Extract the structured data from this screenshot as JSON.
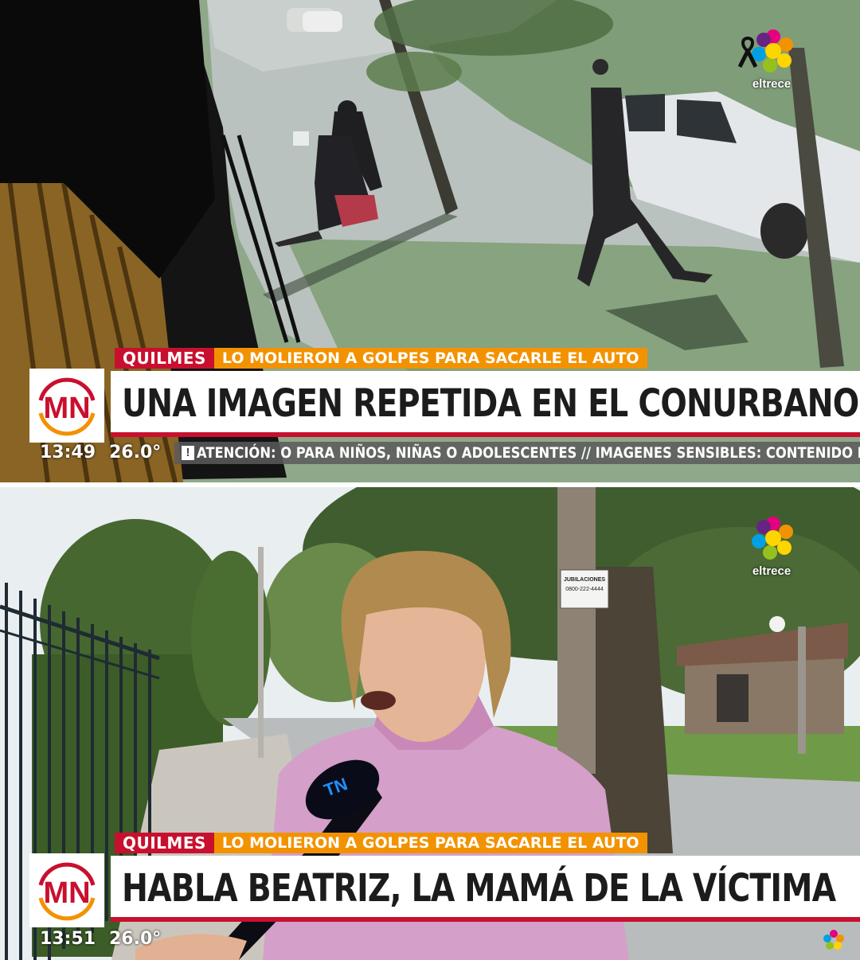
{
  "channel": {
    "name": "eltrece"
  },
  "segments": [
    {
      "kicker_place": "QUILMES",
      "kicker_topic": "LO MOLIERON A GOLPES PARA SACARLE EL AUTO",
      "headline": "UNA IMAGEN REPETIDA EN EL CONURBANO",
      "time": "13:49",
      "temperature": "26.0°",
      "ticker": "ATENCIÓN: O PARA NIÑOS, NIÑAS O ADOLESCENTES // IMAGENES SENSIBLES: CONTENIDO NO APTO PA"
    },
    {
      "kicker_place": "QUILMES",
      "kicker_topic": "LO MOLIERON A GOLPES PARA SACARLE EL AUTO",
      "headline": "HABLA BEATRIZ, LA MAMÁ DE LA VÍCTIMA",
      "time": "13:51",
      "temperature": "26.0°",
      "sign_text": "JUBILACIONES 0800-222-4444"
    }
  ],
  "mic_logo": "TN",
  "colors": {
    "kicker_red": "#c8102e",
    "kicker_orange": "#f39200",
    "mn_red": "#c8102e",
    "mn_orange": "#f39200"
  },
  "icons": [
    "eltrece-logo",
    "mn-logo",
    "alert-icon",
    "mourning-ribbon-icon",
    "tn-mic-logo"
  ]
}
